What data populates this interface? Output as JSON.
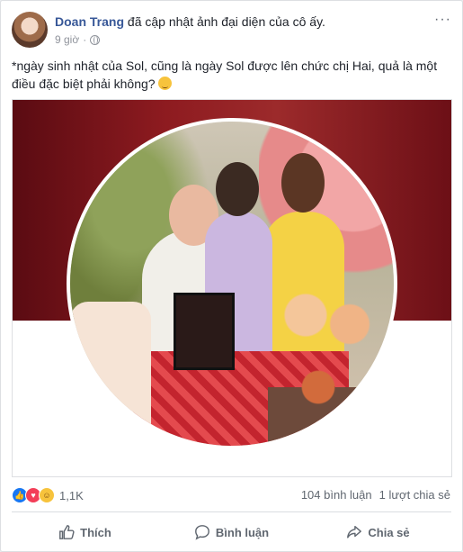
{
  "post": {
    "author": "Doan Trang",
    "action_text": " đã cập nhật ảnh đại diện của cô ấy.",
    "time": "9 giờ",
    "privacy_icon": "globe-icon",
    "more_icon": "···",
    "text": "*ngày sinh nhật của Sol, cũng là ngày Sol được lên chức chị Hai, quả là một điều đặc biệt phải không?"
  },
  "engagement": {
    "reaction_icons": [
      "like-icon",
      "love-icon",
      "haha-icon"
    ],
    "reaction_count": "1,1K",
    "comments": "104 bình luận",
    "shares": "1 lượt chia sẻ"
  },
  "actions": {
    "like": "Thích",
    "comment": "Bình luận",
    "share": "Chia sẻ"
  },
  "colors": {
    "author_link": "#385898",
    "cover_red": "#8e1b20",
    "like_blue": "#1877f2"
  }
}
